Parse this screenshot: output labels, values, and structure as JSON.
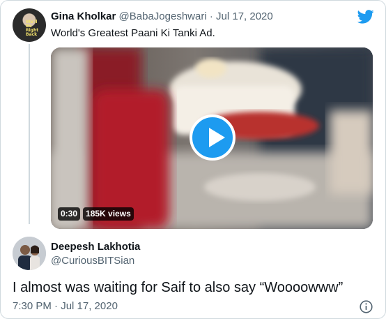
{
  "colors": {
    "brand": "#1d9bf0",
    "text_primary": "#0f1419",
    "text_secondary": "#536471",
    "border": "#cfd9de"
  },
  "quoted_tweet": {
    "display_name": "Gina Kholkar",
    "handle": "@BabaJogeshwari",
    "separator": "·",
    "date": "Jul 17, 2020",
    "text": "World's Greatest Paani Ki Tanki Ad.",
    "avatar_text": "We'll Be Right Back",
    "media": {
      "type": "video",
      "duration": "0:30",
      "views": "185K views",
      "icon": "play-icon"
    }
  },
  "logo_icon": "twitter-bird-icon",
  "tweet": {
    "display_name": "Deepesh Lakhotia",
    "handle": "@CuriousBITSian",
    "text": "I almost was waiting for Saif to also say “Woooowww”",
    "timestamp": "7:30 PM · Jul 17, 2020",
    "info_icon": "info-icon"
  }
}
